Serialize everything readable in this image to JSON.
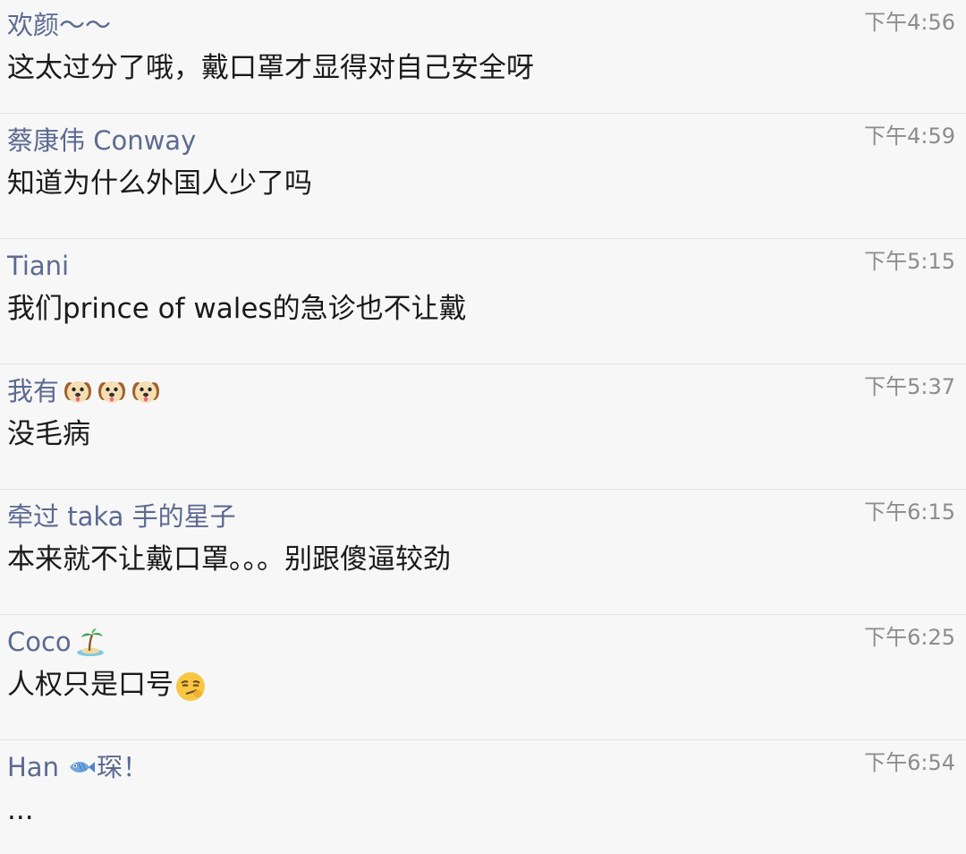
{
  "messages": [
    {
      "name": "欢颜～～",
      "time": "下午4:56",
      "text": "这太过分了哦，戴口罩才显得对自己安全呀",
      "name_icons": [],
      "text_icons": []
    },
    {
      "name": "蔡康伟 Conway",
      "time": "下午4:59",
      "text": "知道为什么外国人少了吗",
      "name_icons": [],
      "text_icons": []
    },
    {
      "name": "Tiani",
      "time": "下午5:15",
      "text": "我们prince of wales的急诊也不让戴",
      "name_icons": [],
      "text_icons": []
    },
    {
      "name": "我有",
      "time": "下午5:37",
      "text": "没毛病",
      "name_icons": [
        "dog-face-emoji-icon",
        "dog-face-emoji-icon",
        "dog-face-emoji-icon"
      ],
      "text_icons": []
    },
    {
      "name": "牵过 taka 手的星子",
      "time": "下午6:15",
      "text": "本来就不让戴口罩。。。别跟傻逼较劲",
      "name_icons": [],
      "text_icons": []
    },
    {
      "name": "Coco",
      "time": "下午6:25",
      "text": "人权只是口号",
      "name_icons": [
        "desert-island-emoji-icon"
      ],
      "text_icons": [
        "smirking-face-emoji-icon"
      ]
    },
    {
      "name": "Han",
      "name_suffix": "琛！",
      "time": "下午6:54",
      "text": "...",
      "name_icons": [
        "fish-emoji-icon"
      ],
      "text_icons": []
    }
  ]
}
